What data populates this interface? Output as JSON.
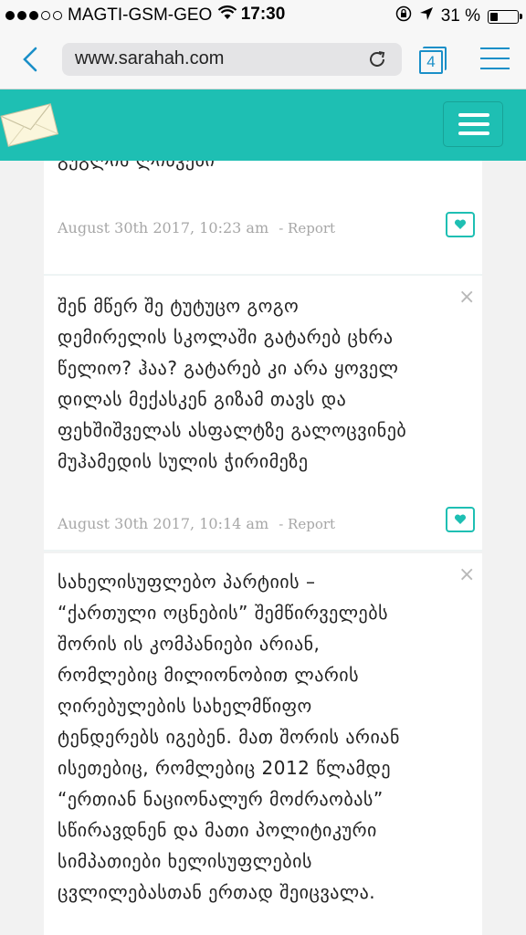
{
  "status_bar": {
    "carrier": "MAGTI-GSM-GEO",
    "time": "17:30",
    "battery": "31 %",
    "battery_level": 0.31,
    "signal_bars": 3,
    "icons": [
      "wifi-icon",
      "orientation-lock-icon",
      "location-arrow-icon",
      "battery-icon"
    ]
  },
  "browser": {
    "url": "www.sarahah.com",
    "tab_count": "4",
    "icons": [
      "back-chevron-icon",
      "reload-icon",
      "tabs-icon",
      "menu-icon"
    ],
    "accent_color": "#1a8fc8"
  },
  "site": {
    "header_color": "#1ebfb3",
    "logo": "envelope-logo",
    "menu_icon": "hamburger-icon"
  },
  "messages": [
    {
      "text": "გუგლის ლინკები",
      "date": "August 30th 2017, 10:23 am",
      "report": "- Report"
    },
    {
      "text": "შენ მწერ შე ტუტუცო გოგო\nდემირელის სკოლაში გატარებ ცხრა\nწელიო? ჰაა? გატარებ კი არა ყოველ\nდილას მექასკენ გიზამ თავს და\nფეხშიშველას ასფალტზე გალოცვინებ\nმუჰამედის სულის ჭირიმეზე",
      "date": "August 30th 2017, 10:14 am",
      "report": "- Report"
    },
    {
      "text": "სახელისუფლებო პარტიის –\n“ქართული ოცნების” შემწირველებს\nშორის ის კომპანიები არიან,\nრომლებიც მილიონობით ლარის\nღირებულების სახელმწიფო\nტენდერებს იგებენ. მათ შორის არიან\nისეთებიც, რომლებიც 2012 წლამდე\n“ერთიან ნაციონალურ მოძრაობას”\nსწირავდნენ და მათი პოლიტიკური\nსიმპათიები ხელისუფლების\nცვლილებასთან ერთად შეიცვალა.",
      "date": "",
      "report": ""
    }
  ]
}
